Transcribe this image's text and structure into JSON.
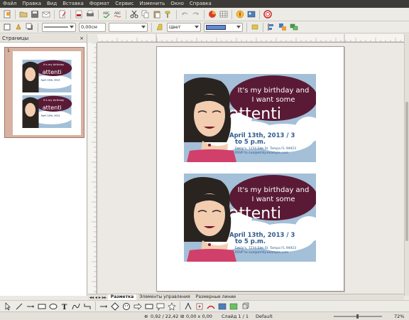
{
  "menu": [
    "Файл",
    "Правка",
    "Вид",
    "Вставка",
    "Формат",
    "Сервис",
    "Изменить",
    "Окно",
    "Справка"
  ],
  "format_toolbar": {
    "line_width": "0,00см",
    "area_style": "Цвет"
  },
  "slides_panel": {
    "title": "Страницы",
    "close": "×",
    "page_number": "1"
  },
  "card": {
    "line1": "It's my birthday and",
    "line2": "I want some",
    "line3": "attenti",
    "date1": "April 13th, 2013 / 3",
    "date2": "to 5 p.m.",
    "address": "Emily's, 1234 Elm St. Tampa FL 94923",
    "rsvp": "RSVP to sue@emily.example.com"
  },
  "tabs": [
    "Разметка",
    "Элементы управления",
    "Размерные линии"
  ],
  "status": {
    "position": "0,92 / 22,42",
    "size": "0,00 x 0,00",
    "slide": "Слайд 1 / 1",
    "layout": "Default",
    "zoom": "72%"
  },
  "colors": {
    "card_bg": "#a4bfd8",
    "bubble": "#5a1a35",
    "cloud": "#ffffff",
    "date_text": "#2e5a8c",
    "menubar": "#3c3b37",
    "selection": "#d8b2a0"
  }
}
